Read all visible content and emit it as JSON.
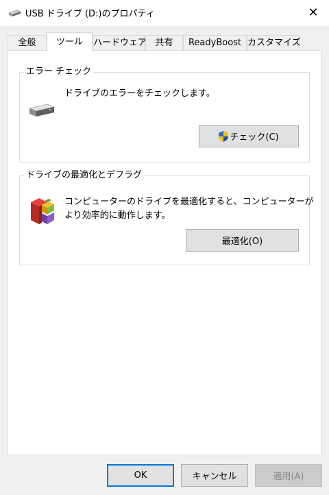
{
  "window": {
    "title": "USB ドライブ (D:)のプロパティ",
    "close_glyph": "✕",
    "drive_icon": "usb-drive-icon"
  },
  "tabs": [
    {
      "label": "全般",
      "active": false
    },
    {
      "label": "ツール",
      "active": true
    },
    {
      "label": "ハードウェア",
      "active": false
    },
    {
      "label": "共有",
      "active": false
    },
    {
      "label": "ReadyBoost",
      "active": false
    },
    {
      "label": "カスタマイズ",
      "active": false
    }
  ],
  "error_check": {
    "group_title": "エラー チェック",
    "description": "ドライブのエラーをチェックします。",
    "button_label": "チェック(C)",
    "drive_icon": "drive-icon",
    "button_icon": "uac-shield-icon"
  },
  "optimize": {
    "group_title": "ドライブの最適化とデフラグ",
    "description_line1": "コンピューターのドライブを最適化すると、コンピューターが",
    "description_line2": "より効率的に動作します。",
    "button_label": "最適化(O)",
    "icon": "defrag-icon"
  },
  "footer": {
    "ok_label": "OK",
    "cancel_label": "キャンセル",
    "apply_label": "適用(A)"
  },
  "colors": {
    "accent": "#0078d7",
    "button_bg": "#e1e1e1",
    "disabled_text": "#838383"
  }
}
